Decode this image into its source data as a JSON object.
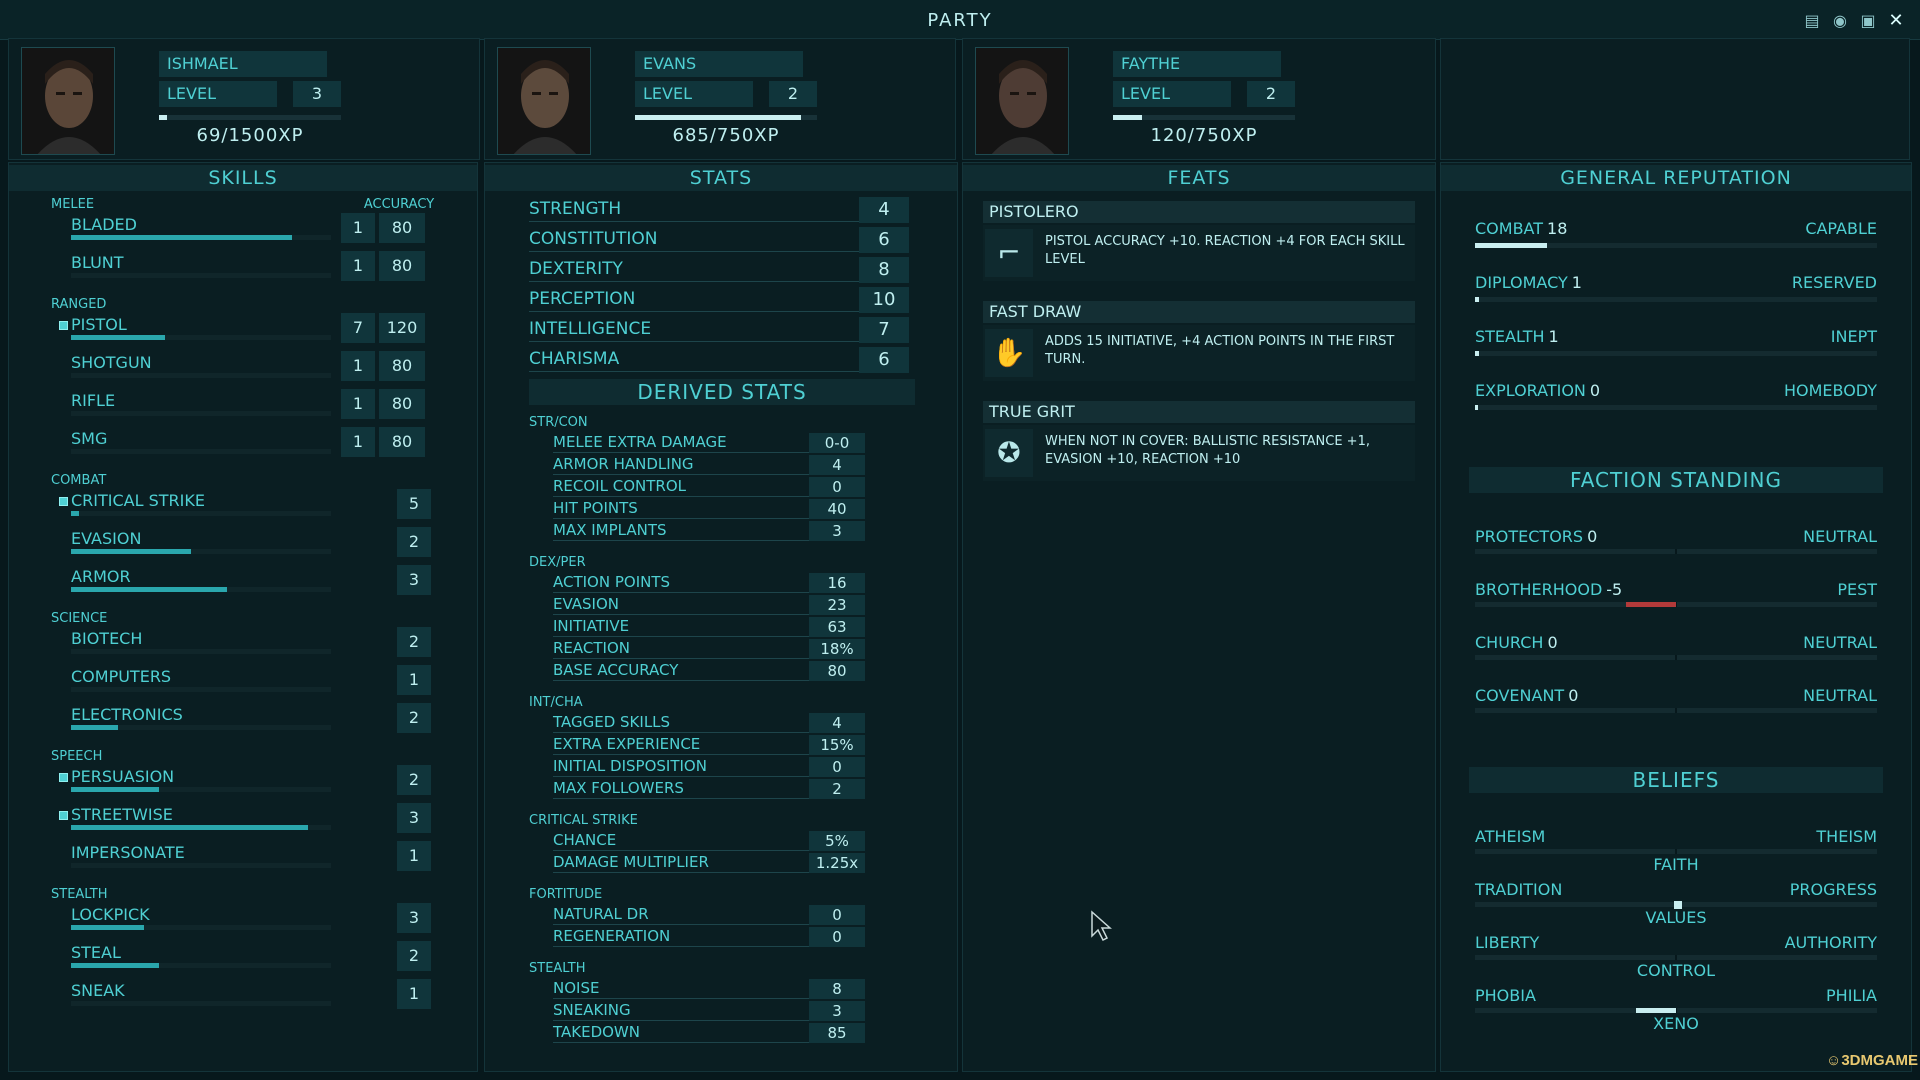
{
  "window": {
    "title": "PARTY"
  },
  "party": [
    {
      "name": "ISHMAEL",
      "level_label": "LEVEL",
      "level": "3",
      "xp_text": "69/1500XP",
      "xp_fraction": 0.046
    },
    {
      "name": "EVANS",
      "level_label": "LEVEL",
      "level": "2",
      "xp_text": "685/750XP",
      "xp_fraction": 0.913
    },
    {
      "name": "FAYTHE",
      "level_label": "LEVEL",
      "level": "2",
      "xp_text": "120/750XP",
      "xp_fraction": 0.16
    }
  ],
  "skills": {
    "title": "SKILLS",
    "accuracy_label": "ACCURACY",
    "categories": [
      {
        "name": "MELEE",
        "items": [
          {
            "name": "BLADED",
            "value": "1",
            "accuracy": "80",
            "tagged": false,
            "fill": 0.85
          },
          {
            "name": "BLUNT",
            "value": "1",
            "accuracy": "80",
            "tagged": false,
            "fill": 0
          }
        ]
      },
      {
        "name": "RANGED",
        "items": [
          {
            "name": "PISTOL",
            "value": "7",
            "accuracy": "120",
            "tagged": true,
            "fill": 0.36
          },
          {
            "name": "SHOTGUN",
            "value": "1",
            "accuracy": "80",
            "tagged": false,
            "fill": 0
          },
          {
            "name": "RIFLE",
            "value": "1",
            "accuracy": "80",
            "tagged": false,
            "fill": 0
          },
          {
            "name": "SMG",
            "value": "1",
            "accuracy": "80",
            "tagged": false,
            "fill": 0
          }
        ]
      },
      {
        "name": "COMBAT",
        "items": [
          {
            "name": "CRITICAL STRIKE",
            "value": "5",
            "tagged": true,
            "fill": 0.03
          },
          {
            "name": "EVASION",
            "value": "2",
            "tagged": false,
            "fill": 0.46
          },
          {
            "name": "ARMOR",
            "value": "3",
            "tagged": false,
            "fill": 0.6
          }
        ]
      },
      {
        "name": "SCIENCE",
        "items": [
          {
            "name": "BIOTECH",
            "value": "2",
            "tagged": false,
            "fill": 0
          },
          {
            "name": "COMPUTERS",
            "value": "1",
            "tagged": false,
            "fill": 0
          },
          {
            "name": "ELECTRONICS",
            "value": "2",
            "tagged": false,
            "fill": 0.18
          }
        ]
      },
      {
        "name": "SPEECH",
        "items": [
          {
            "name": "PERSUASION",
            "value": "2",
            "tagged": true,
            "fill": 0.34
          },
          {
            "name": "STREETWISE",
            "value": "3",
            "tagged": true,
            "fill": 0.91
          },
          {
            "name": "IMPERSONATE",
            "value": "1",
            "tagged": false,
            "fill": 0
          }
        ]
      },
      {
        "name": "STEALTH",
        "items": [
          {
            "name": "LOCKPICK",
            "value": "3",
            "tagged": false,
            "fill": 0.28
          },
          {
            "name": "STEAL",
            "value": "2",
            "tagged": false,
            "fill": 0.34
          },
          {
            "name": "SNEAK",
            "value": "1",
            "tagged": false,
            "fill": 0
          }
        ]
      }
    ]
  },
  "stats": {
    "title": "STATS",
    "attributes": [
      {
        "name": "STRENGTH",
        "value": "4"
      },
      {
        "name": "CONSTITUTION",
        "value": "6"
      },
      {
        "name": "DEXTERITY",
        "value": "8"
      },
      {
        "name": "PERCEPTION",
        "value": "10"
      },
      {
        "name": "INTELLIGENCE",
        "value": "7"
      },
      {
        "name": "CHARISMA",
        "value": "6"
      }
    ],
    "derived_title": "DERIVED STATS",
    "derived": [
      {
        "name": "STR/CON",
        "items": [
          {
            "name": "MELEE EXTRA DAMAGE",
            "value": "0-0"
          },
          {
            "name": "ARMOR HANDLING",
            "value": "4"
          },
          {
            "name": "RECOIL CONTROL",
            "value": "0"
          },
          {
            "name": "HIT POINTS",
            "value": "40"
          },
          {
            "name": "MAX IMPLANTS",
            "value": "3"
          }
        ]
      },
      {
        "name": "DEX/PER",
        "items": [
          {
            "name": "ACTION POINTS",
            "value": "16"
          },
          {
            "name": "EVASION",
            "value": "23"
          },
          {
            "name": "INITIATIVE",
            "value": "63"
          },
          {
            "name": "REACTION",
            "value": "18%"
          },
          {
            "name": "BASE ACCURACY",
            "value": "80"
          }
        ]
      },
      {
        "name": "INT/CHA",
        "items": [
          {
            "name": "TAGGED SKILLS",
            "value": "4"
          },
          {
            "name": "EXTRA EXPERIENCE",
            "value": "15%"
          },
          {
            "name": "INITIAL DISPOSITION",
            "value": "0"
          },
          {
            "name": "MAX FOLLOWERS",
            "value": "2"
          }
        ]
      },
      {
        "name": "CRITICAL STRIKE",
        "items": [
          {
            "name": "CHANCE",
            "value": "5%"
          },
          {
            "name": "DAMAGE MULTIPLIER",
            "value": "1.25x"
          }
        ]
      },
      {
        "name": "FORTITUDE",
        "items": [
          {
            "name": "NATURAL DR",
            "value": "0"
          },
          {
            "name": "REGENERATION",
            "value": "0"
          }
        ]
      },
      {
        "name": "STEALTH",
        "items": [
          {
            "name": "NOISE",
            "value": "8"
          },
          {
            "name": "SNEAKING",
            "value": "3"
          },
          {
            "name": "TAKEDOWN",
            "value": "85"
          }
        ]
      }
    ]
  },
  "feats": {
    "title": "FEATS",
    "items": [
      {
        "name": "PISTOLERO",
        "icon": "pistol-icon",
        "desc": "PISTOL ACCURACY +10. REACTION +4 FOR EACH SKILL LEVEL"
      },
      {
        "name": "FAST DRAW",
        "icon": "hand-draw-icon",
        "desc": "ADDS 15 INITIATIVE, +4 ACTION POINTS IN THE FIRST TURN."
      },
      {
        "name": "TRUE GRIT",
        "icon": "star-badge-icon",
        "desc": "WHEN NOT IN COVER: BALLISTIC RESISTANCE +1, EVASION +10, REACTION +10"
      }
    ]
  },
  "reputation": {
    "title": "GENERAL REPUTATION",
    "items": [
      {
        "name": "COMBAT",
        "value": "18",
        "rank": "CAPABLE",
        "fill": 0.18
      },
      {
        "name": "DIPLOMACY",
        "value": "1",
        "rank": "RESERVED",
        "fill": 0.01
      },
      {
        "name": "STEALTH",
        "value": "1",
        "rank": "INEPT",
        "fill": 0.01
      },
      {
        "name": "EXPLORATION",
        "value": "0",
        "rank": "HOMEBODY",
        "fill": 0
      }
    ]
  },
  "factions": {
    "title": "FACTION STANDING",
    "items": [
      {
        "name": "PROTECTORS",
        "value": "0",
        "rank": "NEUTRAL",
        "standing": 0
      },
      {
        "name": "BROTHERHOOD",
        "value": "-5",
        "rank": "PEST",
        "standing": -0.25
      },
      {
        "name": "CHURCH",
        "value": "0",
        "rank": "NEUTRAL",
        "standing": 0
      },
      {
        "name": "COVENANT",
        "value": "0",
        "rank": "NEUTRAL",
        "standing": 0
      }
    ]
  },
  "beliefs": {
    "title": "BELIEFS",
    "items": [
      {
        "left": "ATHEISM",
        "right": "THEISM",
        "label": "FAITH",
        "position": null
      },
      {
        "left": "TRADITION",
        "right": "PROGRESS",
        "label": "VALUES",
        "position": 0.01
      },
      {
        "left": "LIBERTY",
        "right": "AUTHORITY",
        "label": "CONTROL",
        "position": null
      },
      {
        "left": "PHOBIA",
        "right": "PHILIA",
        "label": "XENO",
        "position": -0.04
      }
    ]
  },
  "colors": {
    "accent": "#4fd0d3",
    "bright": "#bfeff0",
    "bar": "#2aa7ad",
    "negative": "#b33a3a",
    "background": "#07181c"
  }
}
